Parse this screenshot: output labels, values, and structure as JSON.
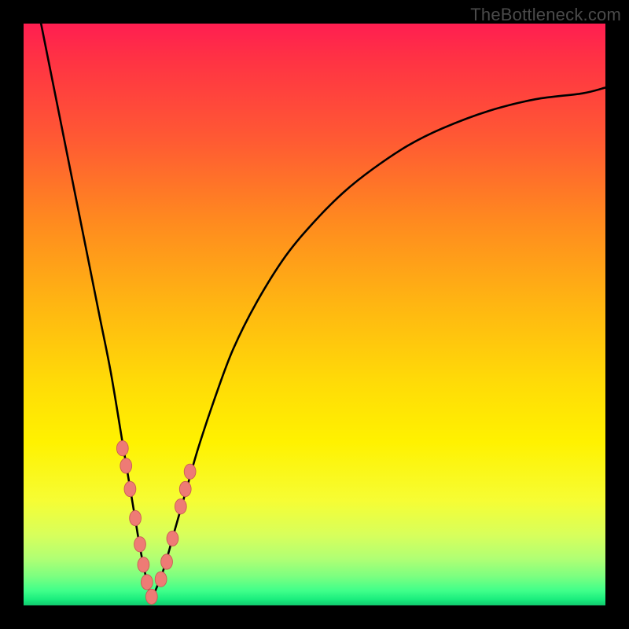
{
  "watermark": {
    "text": "TheBottleneck.com"
  },
  "colors": {
    "background_frame": "#000000",
    "curve": "#000000",
    "dot_fill": "#ee7b75",
    "dot_stroke": "#c95b55",
    "gradient_top": "#ff1e51",
    "gradient_mid": "#fff200",
    "gradient_bottom": "#12c96e"
  },
  "chart_data": {
    "type": "line",
    "title": "",
    "xlabel": "",
    "ylabel": "",
    "xlim": [
      0,
      100
    ],
    "ylim": [
      0,
      100
    ],
    "note": "Bottleneck-style V curve. x is a normalized component-ratio axis (0–100), y is mismatch percent (0 = perfect match / green, 100 = severe bottleneck / red). Curve minimum ≈ x=22. Left branch is steep, right branch rises and saturates near y≈89.",
    "series": [
      {
        "name": "left_branch",
        "x": [
          3,
          5,
          7,
          9,
          11,
          13,
          15,
          17,
          18,
          19,
          20,
          21,
          22
        ],
        "y": [
          100,
          90,
          80,
          70,
          60,
          50,
          40,
          28,
          22,
          16,
          10,
          5,
          1
        ]
      },
      {
        "name": "right_branch",
        "x": [
          22,
          24,
          26,
          28,
          30,
          33,
          36,
          40,
          45,
          50,
          55,
          60,
          66,
          72,
          80,
          88,
          96,
          100
        ],
        "y": [
          1,
          6,
          13,
          20,
          27,
          36,
          44,
          52,
          60,
          66,
          71,
          75,
          79,
          82,
          85,
          87,
          88,
          89
        ]
      }
    ],
    "dots": {
      "name": "highlighted_points_near_minimum",
      "x": [
        17.0,
        17.6,
        18.3,
        19.2,
        20.0,
        20.6,
        21.2,
        22.0,
        23.6,
        24.6,
        25.6,
        27.0,
        27.8,
        28.6
      ],
      "y": [
        27.0,
        24.0,
        20.0,
        15.0,
        10.5,
        7.0,
        4.0,
        1.5,
        4.5,
        7.5,
        11.5,
        17.0,
        20.0,
        23.0
      ]
    }
  }
}
